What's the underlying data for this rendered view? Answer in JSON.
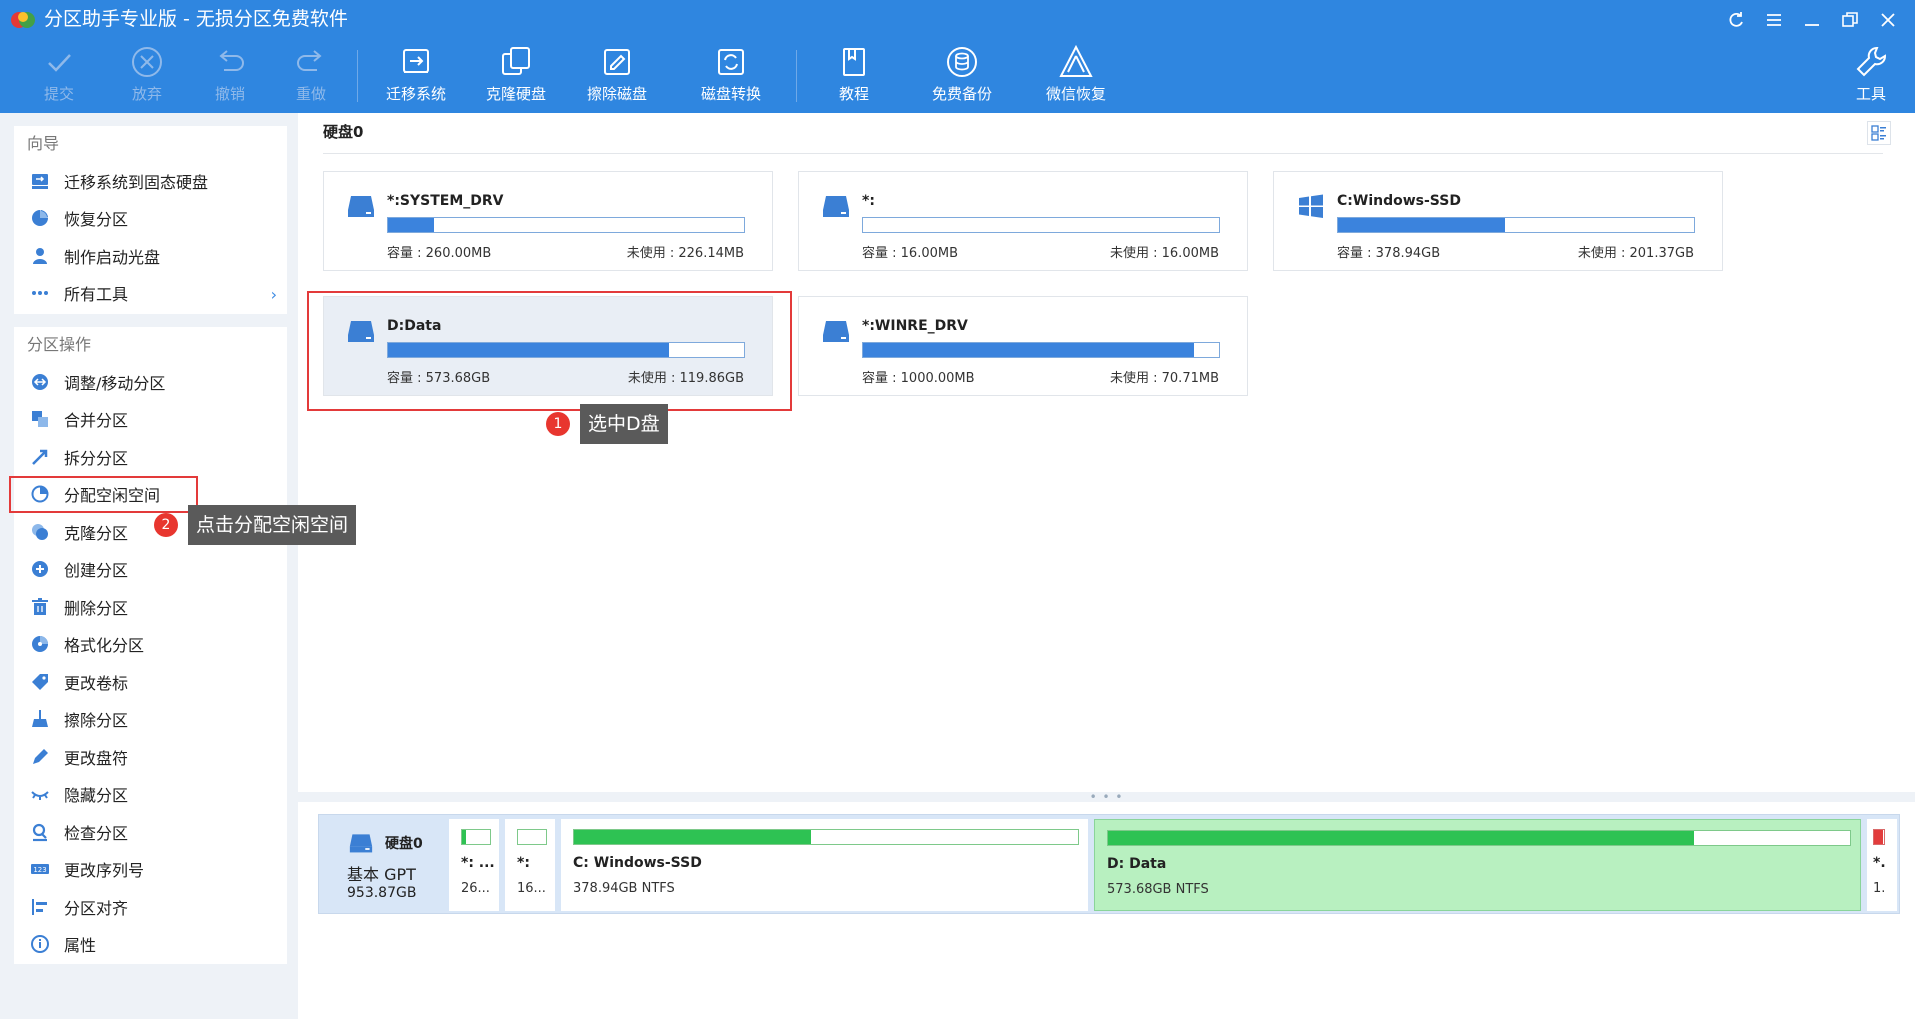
{
  "window": {
    "title": "分区助手专业版 - 无损分区免费软件"
  },
  "toolbar": {
    "commit": "提交",
    "discard": "放弃",
    "undo": "撤销",
    "redo": "重做",
    "migrate_os": "迁移系统",
    "clone_disk": "克隆硬盘",
    "wipe_disk": "擦除磁盘",
    "disk_convert": "磁盘转换",
    "tutorial": "教程",
    "free_backup": "免费备份",
    "wechat_recovery": "微信恢复",
    "tools": "工具"
  },
  "sidebar": {
    "wizard_title": "向导",
    "wizard_items": [
      {
        "label": "迁移系统到固态硬盘",
        "icon": "ssd-migrate-icon"
      },
      {
        "label": "恢复分区",
        "icon": "recover-partition-icon"
      },
      {
        "label": "制作启动光盘",
        "icon": "boot-disc-icon"
      },
      {
        "label": "所有工具",
        "icon": "more-tools-icon"
      }
    ],
    "ops_title": "分区操作",
    "ops_items": [
      {
        "label": "调整/移动分区",
        "icon": "resize-move-icon"
      },
      {
        "label": "合并分区",
        "icon": "merge-icon"
      },
      {
        "label": "拆分分区",
        "icon": "split-icon"
      },
      {
        "label": "分配空闲空间",
        "icon": "allocate-space-icon"
      },
      {
        "label": "克隆分区",
        "icon": "clone-partition-icon"
      },
      {
        "label": "创建分区",
        "icon": "create-partition-icon"
      },
      {
        "label": "删除分区",
        "icon": "delete-icon"
      },
      {
        "label": "格式化分区",
        "icon": "format-icon"
      },
      {
        "label": "更改卷标",
        "icon": "label-tag-icon"
      },
      {
        "label": "擦除分区",
        "icon": "wipe-broom-icon"
      },
      {
        "label": "更改盘符",
        "icon": "pencil-icon"
      },
      {
        "label": "隐藏分区",
        "icon": "hide-icon"
      },
      {
        "label": "检查分区",
        "icon": "check-search-icon"
      },
      {
        "label": "更改序列号",
        "icon": "serial-number-icon"
      },
      {
        "label": "分区对齐",
        "icon": "align-icon"
      },
      {
        "label": "属性",
        "icon": "info-icon"
      }
    ]
  },
  "main": {
    "disk_label": "硬盘0",
    "cap_prefix": "容量 : ",
    "free_prefix": "未使用 : ",
    "cards": [
      {
        "name": "*:SYSTEM_DRV",
        "capacity": "260.00MB",
        "free": "226.14MB",
        "used_fraction": 0.13,
        "icon": "drive-icon"
      },
      {
        "name": "*:",
        "capacity": "16.00MB",
        "free": "16.00MB",
        "used_fraction": 0.0,
        "icon": "drive-icon"
      },
      {
        "name": "C:Windows-SSD",
        "capacity": "378.94GB",
        "free": "201.37GB",
        "used_fraction": 0.47,
        "icon": "windows-logo-icon"
      },
      {
        "name": "D:Data",
        "capacity": "573.68GB",
        "free": "119.86GB",
        "used_fraction": 0.79,
        "icon": "drive-icon"
      },
      {
        "name": "*:WINRE_DRV",
        "capacity": "1000.00MB",
        "free": "70.71MB",
        "used_fraction": 0.93,
        "icon": "drive-icon"
      }
    ]
  },
  "annotations": [
    {
      "num": "1",
      "text": "选中D盘"
    },
    {
      "num": "2",
      "text": "点击分配空闲空间"
    }
  ],
  "diskmap": {
    "disk_name": "硬盘0",
    "disk_type": "基本 GPT",
    "disk_size": "953.87GB",
    "partitions": [
      {
        "name": "*: ...",
        "info": "26...",
        "used_fraction": 0.13
      },
      {
        "name": "*:",
        "info": "16...",
        "used_fraction": 0.0
      },
      {
        "name": "C: Windows-SSD",
        "info": "378.94GB NTFS",
        "used_fraction": 0.47
      },
      {
        "name": "D: Data",
        "info": "573.68GB NTFS",
        "used_fraction": 0.79
      },
      {
        "name": "*.",
        "info": "1.",
        "used_fraction": 0.93
      }
    ]
  },
  "colors": {
    "title_bar": "#2f86e0",
    "selection_red": "#e33a3a",
    "partition_bar_blue": "#3b83dd",
    "map_used_green": "#2ec253",
    "map_selected_bg": "#b8f0c0"
  }
}
